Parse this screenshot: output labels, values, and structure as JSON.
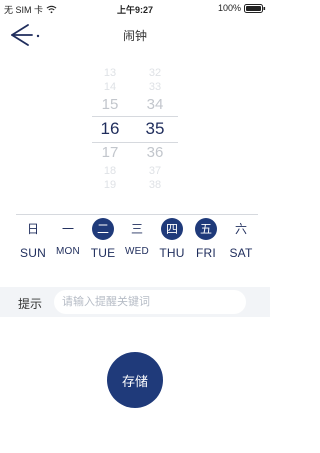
{
  "status_bar": {
    "carrier": "无 SIM 卡",
    "time": "上午9:27",
    "battery": "100%"
  },
  "nav": {
    "title": "闹钟"
  },
  "time_picker": {
    "hours": [
      "13",
      "14",
      "15",
      "16",
      "17",
      "18",
      "19"
    ],
    "minutes": [
      "32",
      "33",
      "34",
      "35",
      "36",
      "37",
      "38"
    ],
    "selected_hour": "16",
    "selected_minute": "35"
  },
  "week": [
    {
      "cn": "日",
      "en": "SUN",
      "active": false
    },
    {
      "cn": "一",
      "en": "MON",
      "active": false
    },
    {
      "cn": "二",
      "en": "TUE",
      "active": true
    },
    {
      "cn": "三",
      "en": "WED",
      "active": false
    },
    {
      "cn": "四",
      "en": "THU",
      "active": true
    },
    {
      "cn": "五",
      "en": "FRI",
      "active": true
    },
    {
      "cn": "六",
      "en": "SAT",
      "active": false
    }
  ],
  "hint": {
    "label": "提示",
    "placeholder": "请输入提醒关键词",
    "value": ""
  },
  "save": {
    "label": "存储"
  },
  "colors": {
    "accent": "#1f3a7a",
    "text": "#1f2d5c",
    "muted": "#c2c6cc",
    "hint_bg": "#f2f4f7"
  }
}
